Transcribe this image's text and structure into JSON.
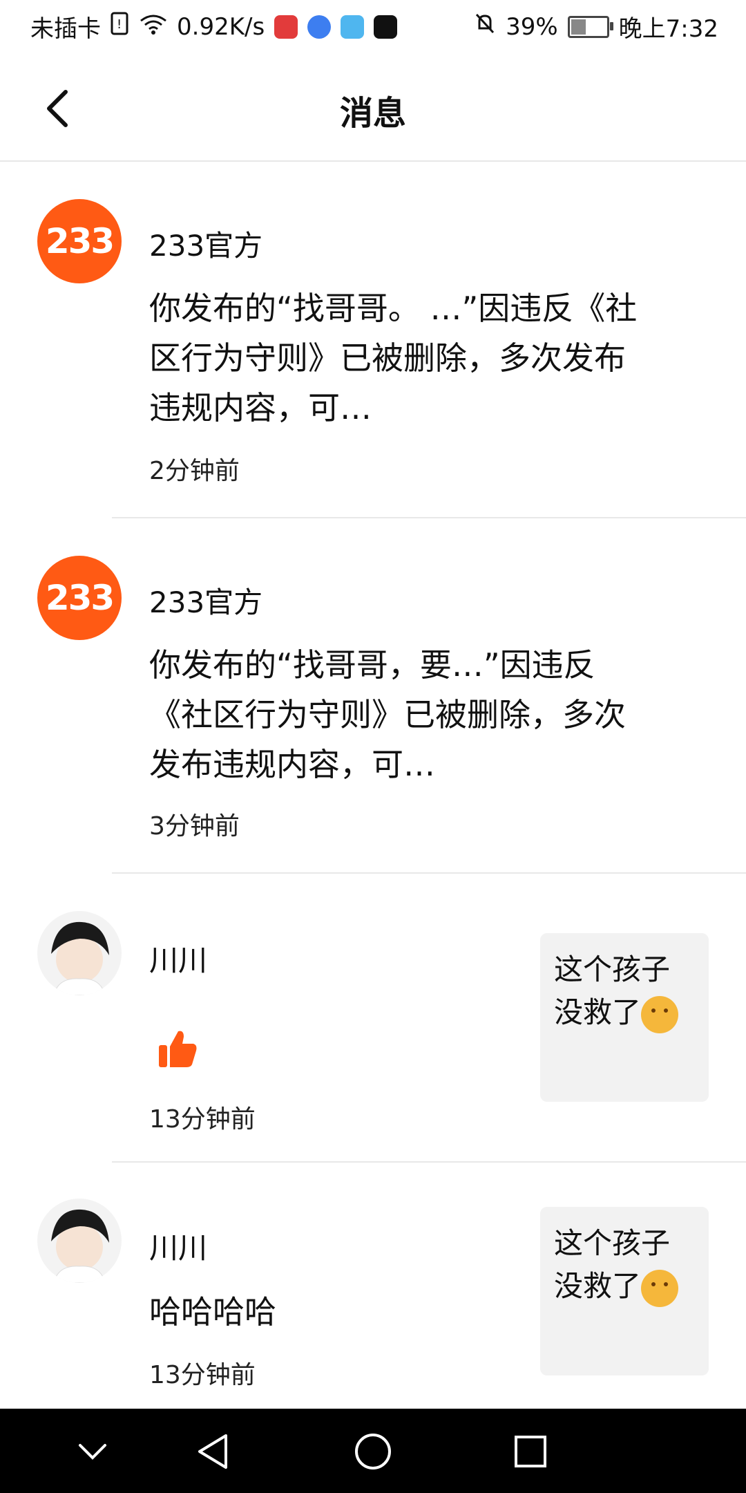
{
  "status_bar": {
    "left_text": "未插卡",
    "speed": "0.92K/s",
    "battery": "39%",
    "battery_level": 0.39,
    "time": "晚上7:32"
  },
  "header": {
    "title": "消息"
  },
  "messages": [
    {
      "avatar_text": "233",
      "name": "233官方",
      "content": "你发布的“找哥哥。 …”因违反《社区行为守则》已被删除，多次发布违规内容，可…",
      "time": "2分钟前"
    },
    {
      "avatar_text": "233",
      "name": "233官方",
      "content": "你发布的“找哥哥，要…”因违反《社区行为守则》已被删除，多次发布违规内容，可…",
      "time": "3分钟前"
    },
    {
      "name": "川川",
      "reaction": "thumbs-up-icon",
      "time": "13分钟前",
      "preview": "这个孩子没救了"
    },
    {
      "name": "川川",
      "content": "哈哈哈哈",
      "time": "13分钟前",
      "preview": "这个孩子没救了"
    }
  ],
  "colors": {
    "brand": "#ff5a14",
    "like": "#ff5a14",
    "preview_bg": "#f2f2f2"
  }
}
